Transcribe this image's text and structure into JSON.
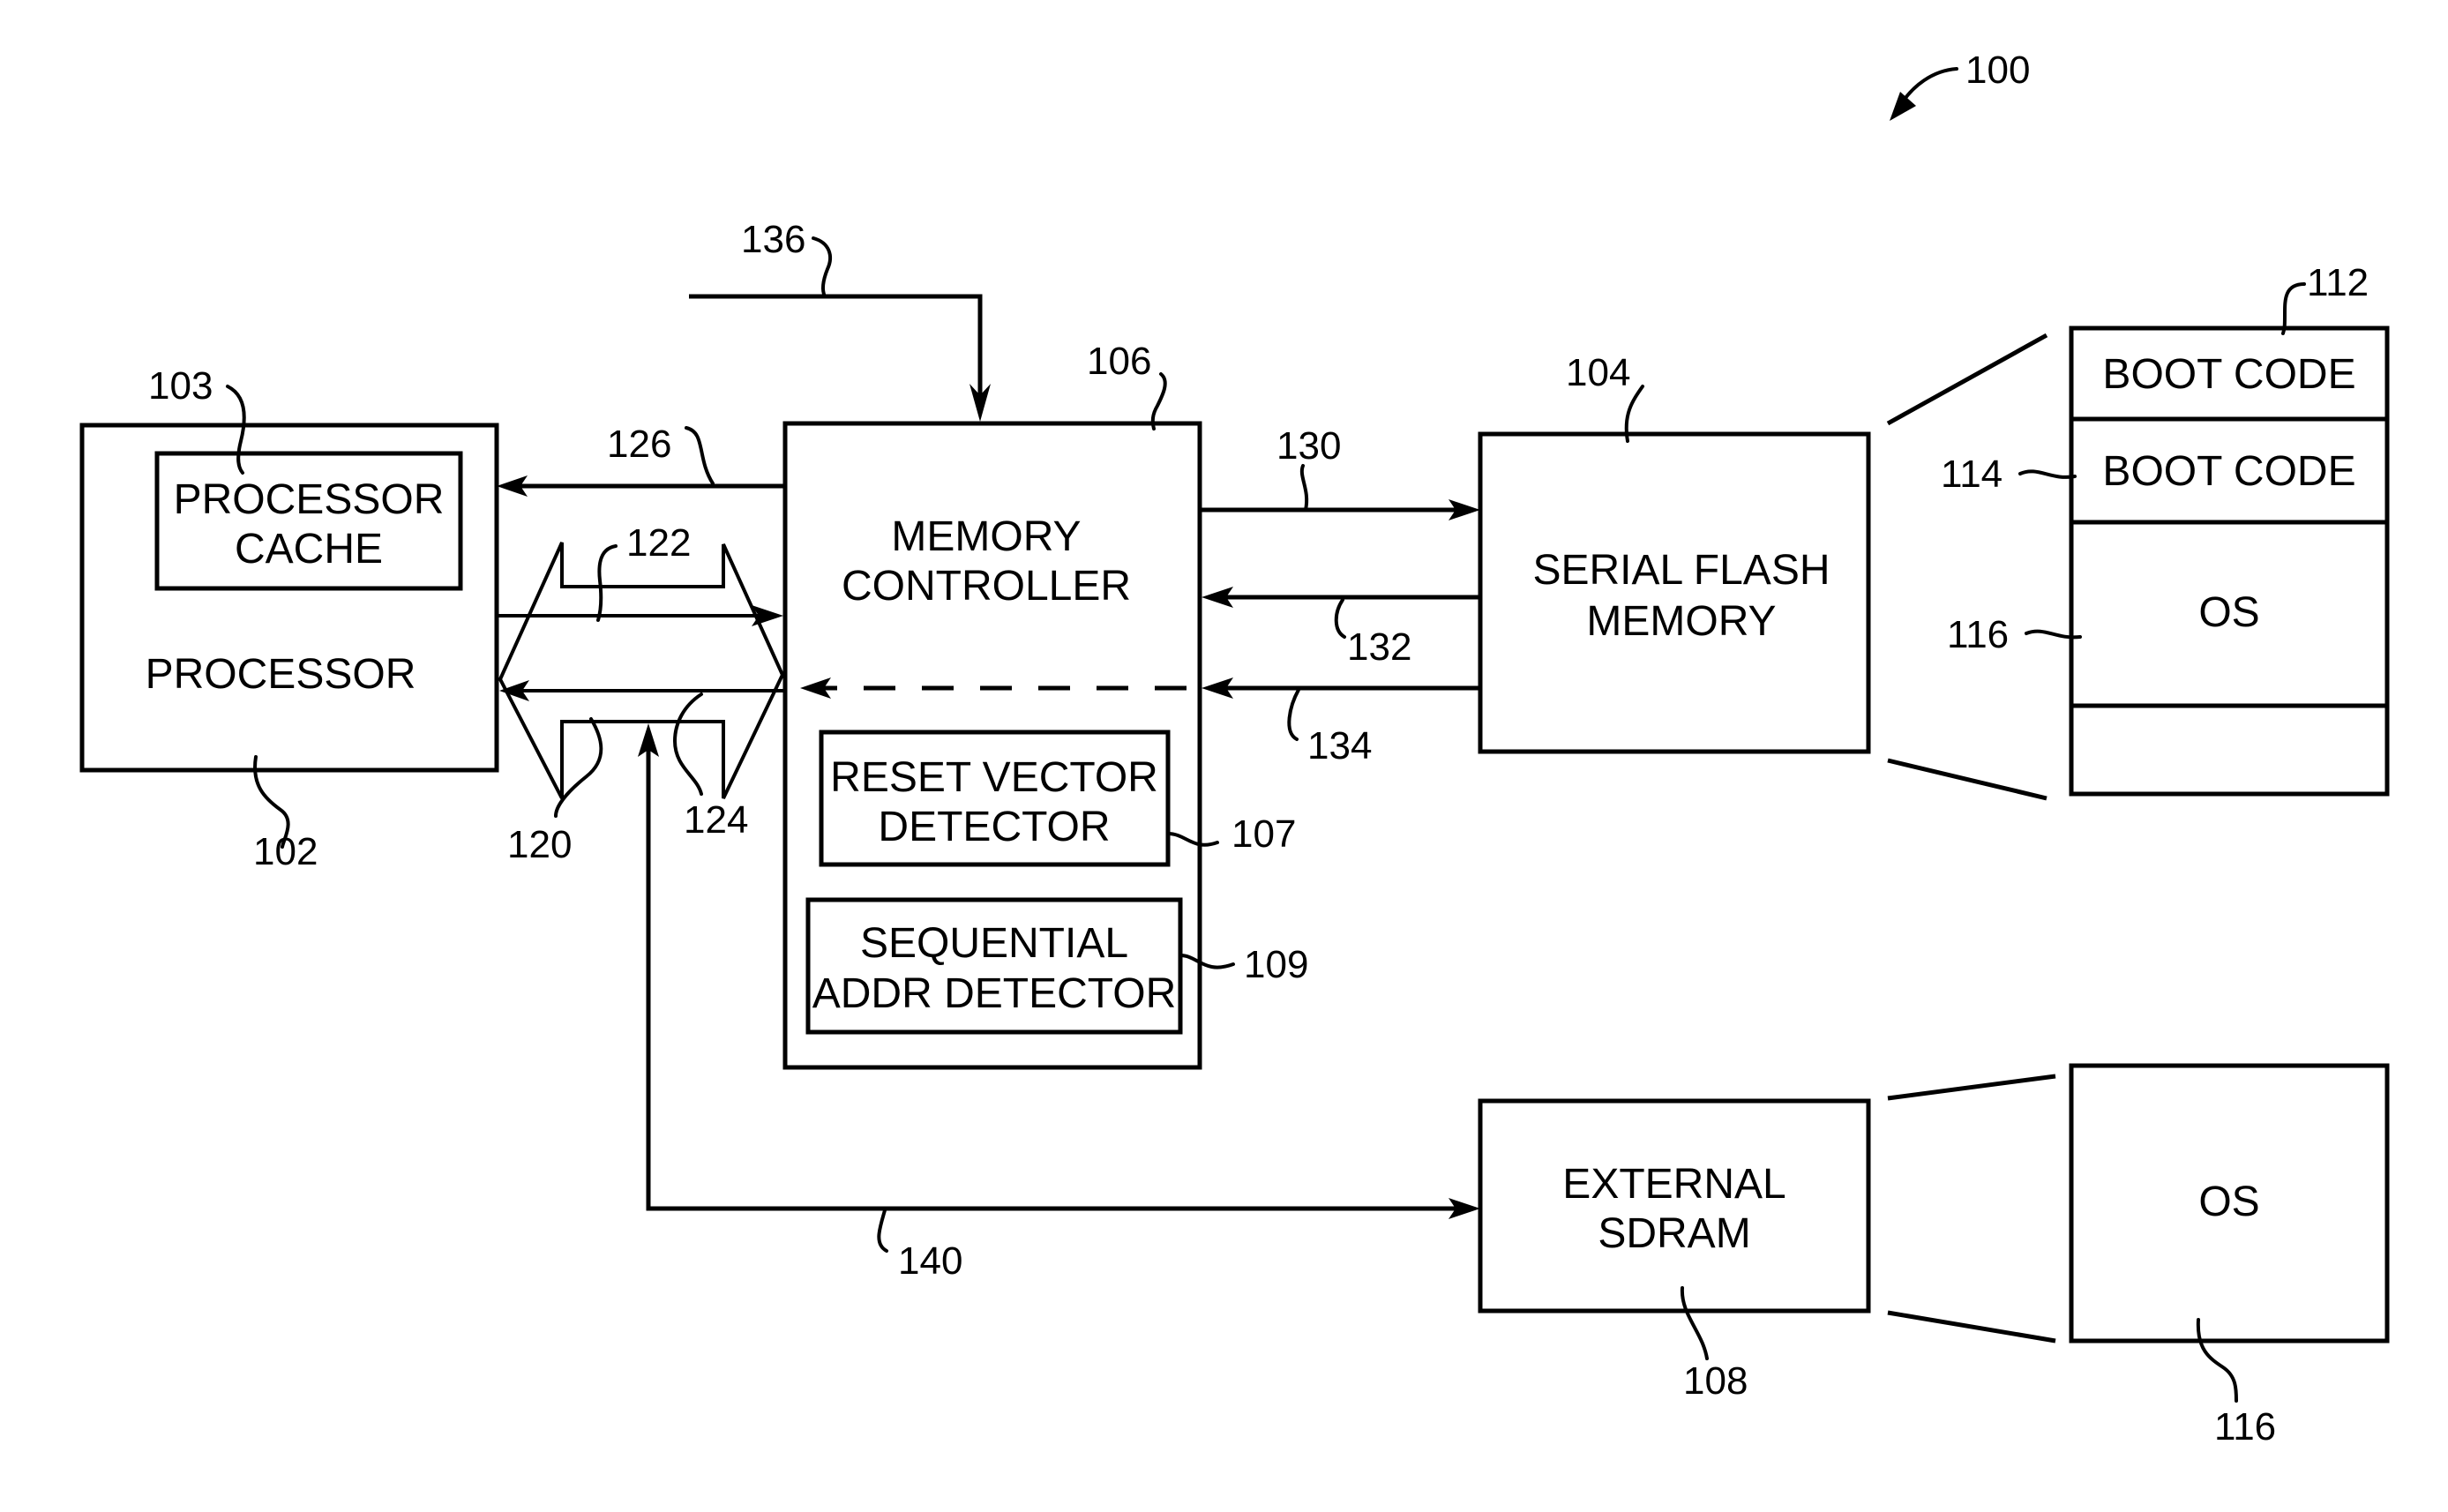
{
  "figure": {
    "reference_number": "100"
  },
  "blocks": {
    "processor": {
      "label": "PROCESSOR",
      "ref": "102"
    },
    "processor_cache": {
      "label_line1": "PROCESSOR",
      "label_line2": "CACHE",
      "ref": "103"
    },
    "memory_controller": {
      "label_line1": "MEMORY",
      "label_line2": "CONTROLLER",
      "ref": "106"
    },
    "reset_vector_detector": {
      "label_line1": "RESET VECTOR",
      "label_line2": "DETECTOR",
      "ref": "107"
    },
    "sequential_addr_detector": {
      "label_line1": "SEQUENTIAL",
      "label_line2": "ADDR DETECTOR",
      "ref": "109"
    },
    "serial_flash_memory": {
      "label_line1": "SERIAL FLASH",
      "label_line2": "MEMORY",
      "ref": "104"
    },
    "external_sdram": {
      "label_line1": "EXTERNAL",
      "label_line2": "SDRAM",
      "ref": "108"
    }
  },
  "flash_memory_map": {
    "segments": [
      {
        "label": "BOOT CODE",
        "ref": "112"
      },
      {
        "label": "BOOT CODE",
        "ref": "114"
      },
      {
        "label": "OS",
        "ref": "116"
      },
      {
        "label": "",
        "ref": ""
      }
    ]
  },
  "sdram_memory_map": {
    "segments": [
      {
        "label": "OS",
        "ref": "116"
      }
    ]
  },
  "signals": {
    "bus_bidirectional": "120",
    "bus_to_controller": "122",
    "bus_to_processor": "124",
    "controller_to_processor": "126",
    "controller_to_flash": "130",
    "flash_to_controller": "132",
    "flash_bypass_to_processor": "134",
    "external_input_to_controller": "136",
    "bus_to_sdram": "140"
  }
}
